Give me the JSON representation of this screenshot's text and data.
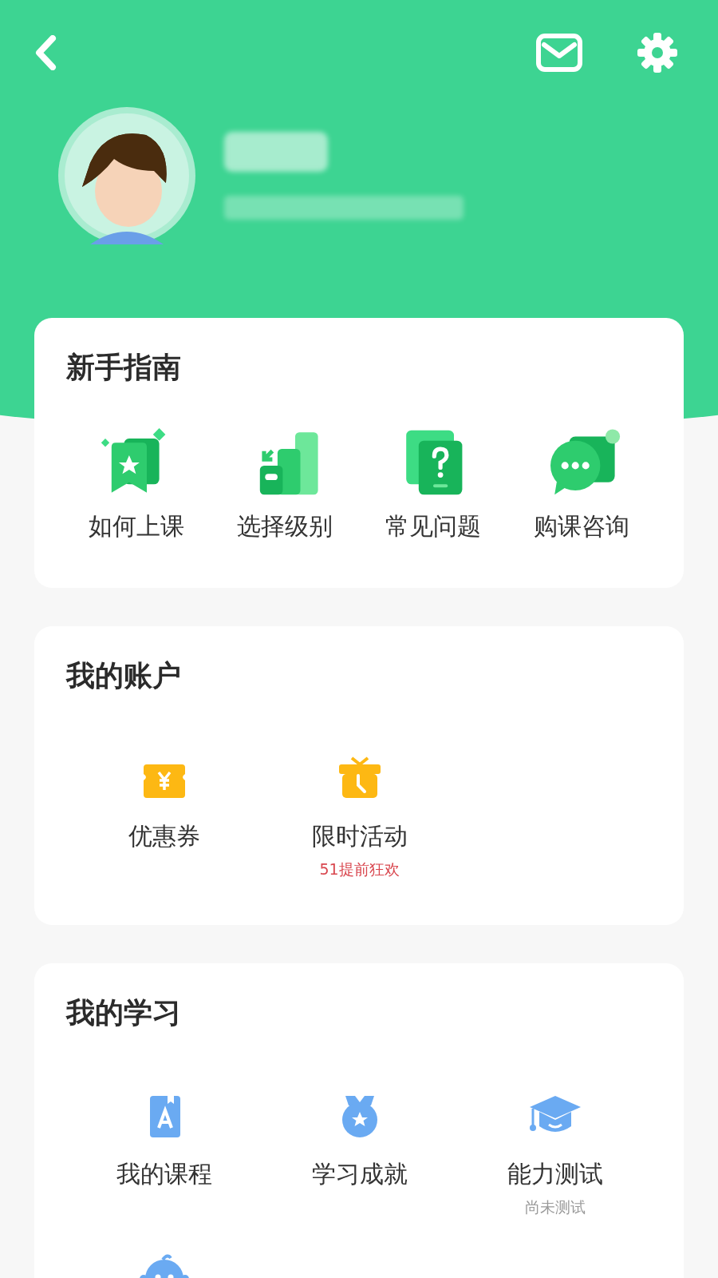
{
  "sections": [
    {
      "title": "新手指南",
      "kind": "four-up",
      "items": [
        {
          "kind": "bookmark-star",
          "label": "如何上课"
        },
        {
          "kind": "bars",
          "label": "选择级别"
        },
        {
          "kind": "question",
          "label": "常见问题"
        },
        {
          "kind": "chat",
          "label": "购课咨询"
        }
      ]
    },
    {
      "title": "我的账户",
      "kind": "three-up",
      "items": [
        {
          "kind": "coupon",
          "label": "优惠券"
        },
        {
          "kind": "gift",
          "label": "限时活动",
          "note": {
            "text": "51提前狂欢",
            "color": "#d9474f"
          }
        }
      ]
    },
    {
      "title": "我的学习",
      "kind": "three-up",
      "items": [
        {
          "kind": "book",
          "label": "我的课程"
        },
        {
          "kind": "medal",
          "label": "学习成就"
        },
        {
          "kind": "cap",
          "label": "能力测试",
          "note": {
            "text": "尚未测试",
            "color": "#999999"
          }
        },
        {
          "kind": "baby"
        }
      ]
    }
  ]
}
